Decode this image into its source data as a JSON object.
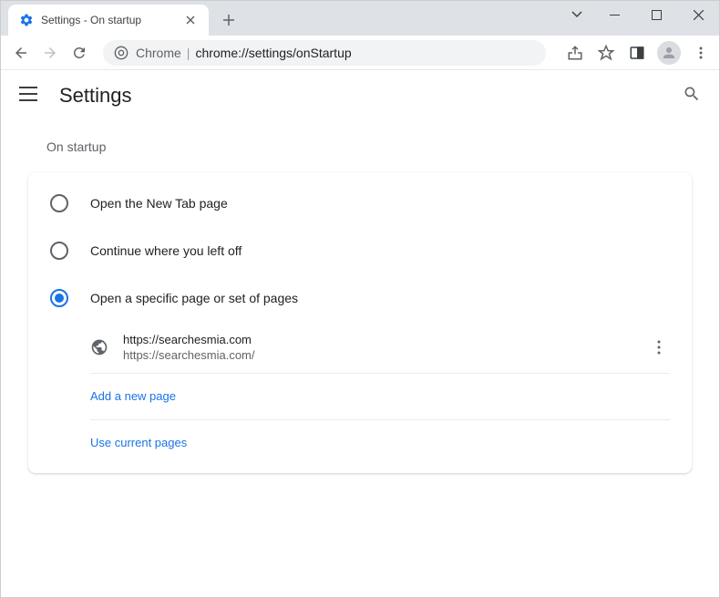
{
  "tab": {
    "title": "Settings - On startup"
  },
  "omnibox": {
    "scheme": "Chrome",
    "path": "chrome://settings/onStartup"
  },
  "header": {
    "title": "Settings"
  },
  "section": {
    "title": "On startup",
    "options": [
      {
        "label": "Open the New Tab page",
        "selected": false
      },
      {
        "label": "Continue where you left off",
        "selected": false
      },
      {
        "label": "Open a specific page or set of pages",
        "selected": true
      }
    ],
    "pages": [
      {
        "title": "https://searchesmia.com",
        "url": "https://searchesmia.com/"
      }
    ],
    "links": {
      "add": "Add a new page",
      "use_current": "Use current pages"
    }
  }
}
